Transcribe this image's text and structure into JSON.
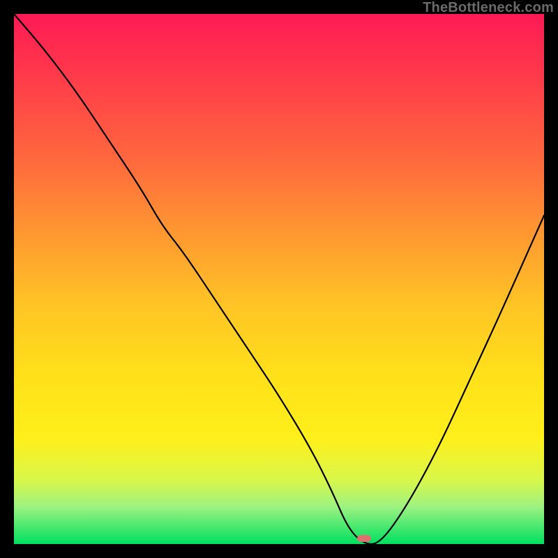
{
  "watermark": "TheBottleneck.com",
  "marker": {
    "x_pct": 66,
    "y_pct": 99
  },
  "chart_data": {
    "type": "line",
    "title": "",
    "xlabel": "",
    "ylabel": "",
    "xlim": [
      0,
      100
    ],
    "ylim": [
      0,
      100
    ],
    "x": [
      0,
      6,
      12,
      18,
      24,
      28,
      32,
      38,
      44,
      50,
      56,
      60,
      63,
      66,
      69,
      74,
      80,
      86,
      92,
      100
    ],
    "values": [
      100,
      93,
      85,
      76,
      67,
      60,
      55,
      46,
      37,
      28,
      18,
      10,
      3,
      0,
      0,
      7,
      18,
      31,
      44,
      62
    ],
    "annotations": [],
    "legend": [],
    "grid": false
  }
}
